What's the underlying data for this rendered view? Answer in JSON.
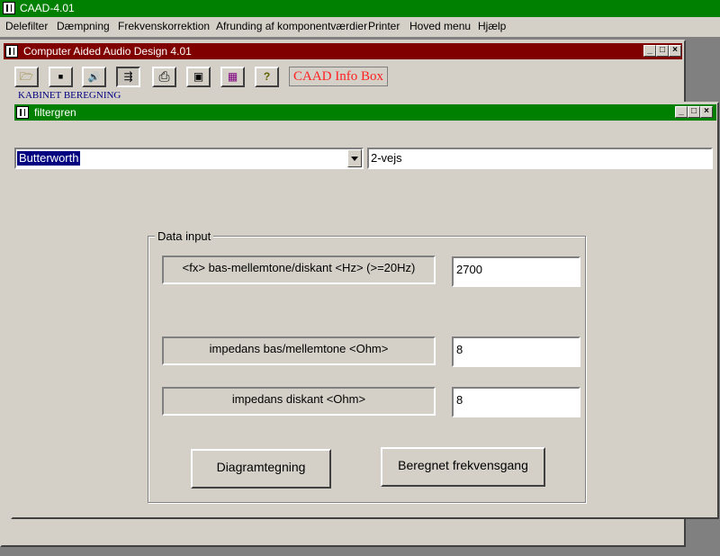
{
  "app": {
    "title": "CAAD-4.01",
    "menu": [
      "Delefilter",
      "Dæmpning",
      "Frekvenskorrektion",
      "Afrunding af komponentværdier",
      "Printer",
      "Hoved menu",
      "Hjælp"
    ]
  },
  "main_window": {
    "title": "Computer Aided Audio Design 4.01",
    "toolbar": [
      {
        "name": "open-folder-icon",
        "glyph": "🗁"
      },
      {
        "name": "save-disk-icon",
        "glyph": "▪"
      },
      {
        "name": "speaker-icon",
        "glyph": "🔊"
      },
      {
        "name": "crossover-icon",
        "glyph": "⇶"
      },
      {
        "name": "printer-icon",
        "glyph": "⎙"
      },
      {
        "name": "calculator-icon",
        "glyph": "▣"
      },
      {
        "name": "grid-icon",
        "glyph": "▦"
      },
      {
        "name": "help-icon",
        "glyph": "?"
      }
    ],
    "info_box": "CAAD Info Box",
    "background_label": "KABINET BEREGNING"
  },
  "filter_window": {
    "title": "filtergren",
    "filter_type": "Butterworth",
    "ways": "2-vejs",
    "group_title": "Data input",
    "fields": [
      {
        "label": "<fx> bas-mellemtone/diskant <Hz> (>=20Hz)",
        "value": "2700"
      },
      {
        "label": "impedans bas/mellemtone <Ohm>",
        "value": "8"
      },
      {
        "label": "impedans diskant <Ohm>",
        "value": "8"
      }
    ],
    "buttons": {
      "diagram": "Diagramtegning",
      "frequency": "Beregnet frekvensgang"
    }
  },
  "colors": {
    "title_green": "#008000",
    "title_maroon": "#800000",
    "selection_blue": "#000080",
    "info_red": "#ff2020"
  }
}
